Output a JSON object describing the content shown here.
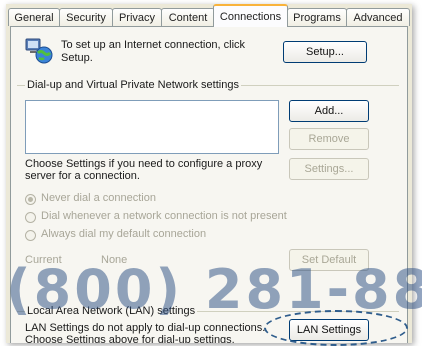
{
  "tabs": [
    {
      "label": "General"
    },
    {
      "label": "Security"
    },
    {
      "label": "Privacy"
    },
    {
      "label": "Content"
    },
    {
      "label": "Connections"
    },
    {
      "label": "Programs"
    },
    {
      "label": "Advanced"
    }
  ],
  "active_tab": "Connections",
  "setup": {
    "text": "To set up an Internet connection, click Setup.",
    "button": "Setup..."
  },
  "dialup": {
    "group_label": "Dial-up and Virtual Private Network settings",
    "add_button": "Add...",
    "remove_button": "Remove",
    "settings_text": "Choose Settings if you need to configure a proxy server for a connection.",
    "settings_button": "Settings...",
    "radio_never": "Never dial a connection",
    "radio_whenever": "Dial whenever a network connection is not present",
    "radio_always": "Always dial my default connection",
    "current_label": "Current",
    "current_value": "None",
    "set_default_button": "Set Default"
  },
  "lan": {
    "group_label": "Local Area Network (LAN) settings",
    "text": "LAN Settings do not apply to dial-up connections. Choose Settings above for dial-up settings.",
    "button": "LAN Settings"
  },
  "watermark": "(800) 281-88",
  "icon": "network-globe-icon"
}
